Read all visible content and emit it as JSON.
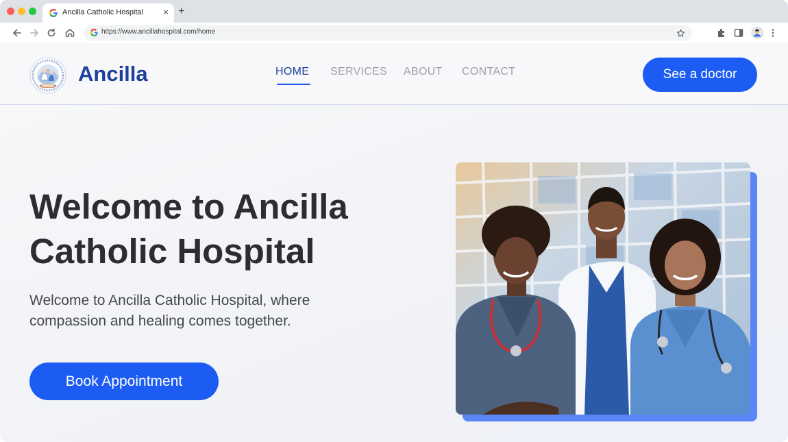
{
  "browser": {
    "tab_title": "Ancilla Catholic Hospital",
    "url": "https://www.ancillahospital.com/home",
    "new_tab_symbol": "+",
    "close_symbol": "×"
  },
  "header": {
    "brand": "Ancilla",
    "nav": [
      {
        "label": "HOME",
        "active": true
      },
      {
        "label": "SERVICES",
        "active": false
      },
      {
        "label": "ABOUT",
        "active": false
      },
      {
        "label": "CONTACT",
        "active": false
      }
    ],
    "cta_label": "See a doctor"
  },
  "hero": {
    "title_line1": "Welcome to Ancilla",
    "title_line2": "Catholic Hospital",
    "subtitle_line1": "Welcome to Ancilla Catholic Hospital, where",
    "subtitle_line2": "compassion and healing comes together.",
    "button_label": "Book Appointment"
  },
  "colors": {
    "accent": "#1d5cf2",
    "brand": "#1d3f9c",
    "heading": "#2b2d33",
    "nav_inactive": "#9aa0ad"
  }
}
